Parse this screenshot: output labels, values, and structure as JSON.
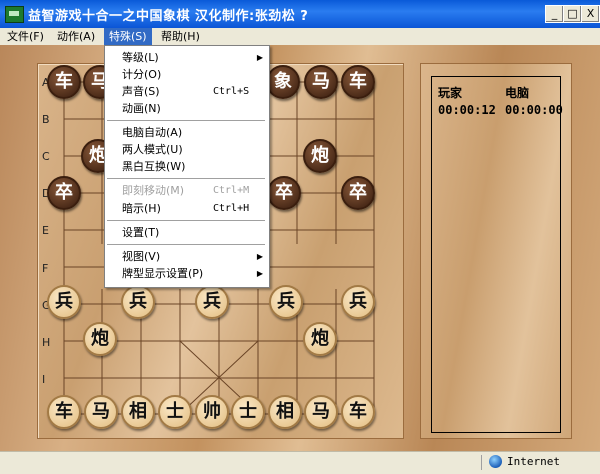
{
  "window": {
    "title": "益智游戏十合一之中国象棋   汉化制作:张劲松 ?",
    "controls": {
      "minimize": "_",
      "maximize": "□",
      "close": "X"
    }
  },
  "menubar": {
    "items": [
      {
        "label": "文件(F)"
      },
      {
        "label": "动作(A)"
      },
      {
        "label": "特殊(S)"
      },
      {
        "label": "帮助(H)"
      }
    ]
  },
  "dropdown": {
    "items": [
      {
        "label": "等级(L)",
        "submenu": true
      },
      {
        "label": "计分(O)"
      },
      {
        "label": "声音(S)",
        "shortcut": "Ctrl+S"
      },
      {
        "label": "动画(N)"
      },
      {
        "label": "电脑自动(A)"
      },
      {
        "label": "两人模式(U)"
      },
      {
        "label": "黑白互换(W)"
      },
      {
        "label": "即刻移动(M)",
        "shortcut": "Ctrl+M",
        "disabled": true
      },
      {
        "label": "暗示(H)",
        "shortcut": "Ctrl+H"
      },
      {
        "label": "设置(T)"
      },
      {
        "label": "视图(V)",
        "submenu": true
      },
      {
        "label": "牌型显示设置(P)",
        "submenu": true
      }
    ],
    "submenu_arrow": "▶"
  },
  "board": {
    "row_labels": [
      "A",
      "B",
      "C",
      "D",
      "E",
      "F",
      "G",
      "H",
      "I"
    ],
    "black_pieces": [
      "车",
      "马",
      "象",
      "马",
      "车",
      "炮",
      "炮",
      "卒",
      "卒",
      "卒"
    ],
    "red_pieces": [
      "兵",
      "兵",
      "兵",
      "兵",
      "兵",
      "炮",
      "炮",
      "车",
      "马",
      "相",
      "士",
      "帅",
      "士",
      "相",
      "马",
      "车"
    ]
  },
  "scoreboard": {
    "player_label": "玩家",
    "computer_label": "电脑",
    "player_time": "00:00:12",
    "computer_time": "00:00:00"
  },
  "statusbar": {
    "zone": "Internet"
  }
}
